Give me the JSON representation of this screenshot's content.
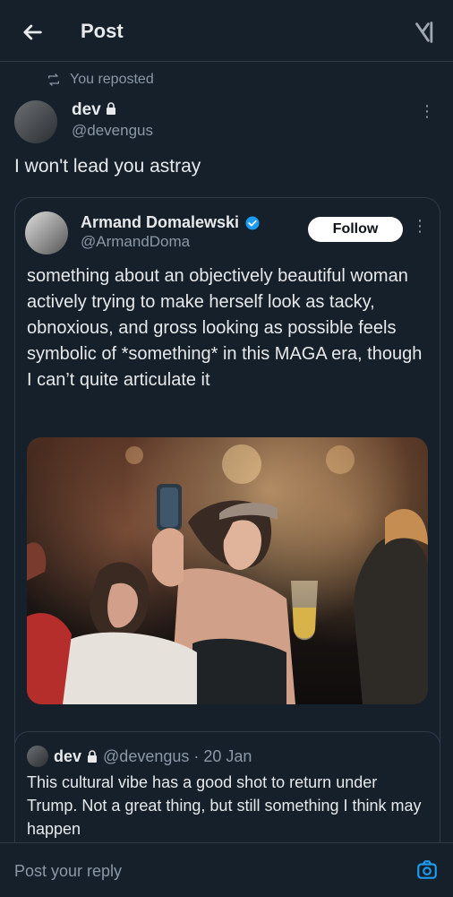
{
  "header": {
    "title": "Post"
  },
  "repost": {
    "text": "You reposted"
  },
  "post": {
    "name": "dev",
    "handle": "@devengus",
    "text": "I won't lead you astray"
  },
  "quote": {
    "name": "Armand Domalewski",
    "handle": "@ArmandDoma",
    "follow": "Follow",
    "text": "something about an objectively beautiful woman actively trying to make herself look as tacky, obnoxious, and gross looking as possible feels symbolic of *something* in this MAGA era, though I can’t quite articulate it"
  },
  "nested": {
    "name": "dev",
    "meta": "@devengus · 20 Jan",
    "text": "This cultural vibe has a good shot to return under Trump. Not a great thing, but still something I think may happen"
  },
  "reply": {
    "placeholder": "Post your reply"
  },
  "colors": {
    "accent": "#1d9bf0",
    "bg": "#15202b",
    "muted": "#8b98a5"
  }
}
